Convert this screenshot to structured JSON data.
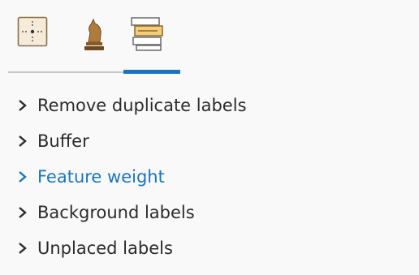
{
  "tabs": [
    {
      "name": "Position",
      "icon": "label-position-icon",
      "active": false
    },
    {
      "name": "Rank",
      "icon": "chess-knight-icon",
      "active": false
    },
    {
      "name": "Conflict resolution",
      "icon": "label-stack-icon",
      "active": true
    }
  ],
  "sections": [
    {
      "label": "Remove duplicate labels",
      "active": false
    },
    {
      "label": "Buffer",
      "active": false
    },
    {
      "label": "Feature weight",
      "active": true
    },
    {
      "label": "Background labels",
      "active": false
    },
    {
      "label": "Unplaced labels",
      "active": false
    }
  ],
  "colors": {
    "accent": "#1a75c0",
    "text": "#2b2b2b",
    "background": "#f9f9f9"
  }
}
